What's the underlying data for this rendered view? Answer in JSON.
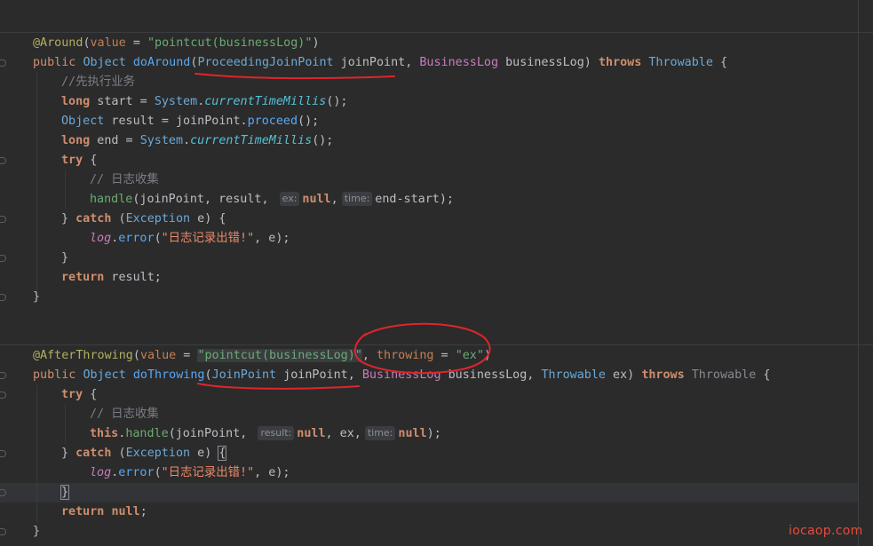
{
  "editor": {
    "watermark": "iocaop.com",
    "annotation_color": "#e0252b",
    "colors": {
      "background": "#2b2b2b",
      "keyword": "#cf8e6d",
      "annotation": "#b3ae60",
      "type": "#6aa9d8",
      "string": "#6aab73",
      "comment": "#7a7e85"
    }
  },
  "code": {
    "l1": {
      "t1": "@Around",
      "t2": "(",
      "t3": "value",
      "t4": " = ",
      "t5": "\"pointcut(businessLog)\"",
      "t6": ")"
    },
    "l2": {
      "t1": "public",
      "t2": " ",
      "t3": "Object",
      "t4": " ",
      "t5": "doAround",
      "t6": "(",
      "t7": "ProceedingJoinPoint",
      "t8": " joinPoint, ",
      "t9": "BusinessLog",
      "t10": " businessLog) ",
      "t11": "throws",
      "t12": " ",
      "t13": "Throwable",
      "t14": " {"
    },
    "l3": {
      "t1": "//先执行业务"
    },
    "l4": {
      "t1": "long",
      "t2": " start = ",
      "t3": "System",
      "t4": ".",
      "t5": "currentTimeMillis",
      "t6": "();"
    },
    "l5": {
      "t1": "Object",
      "t2": " result = joinPoint.",
      "t3": "proceed",
      "t4": "();"
    },
    "l6": {
      "t1": "long",
      "t2": " end = ",
      "t3": "System",
      "t4": ".",
      "t5": "currentTimeMillis",
      "t6": "();"
    },
    "l7": {
      "t1": "try",
      "t2": " {"
    },
    "l8": {
      "t1": "// 日志收集"
    },
    "l9": {
      "t1": "handle",
      "t2": "(joinPoint, result, ",
      "h1": "ex:",
      "t3": "null",
      "t4": ",",
      "h2": "time:",
      "t5": "end-start);"
    },
    "l10": {
      "t1": "} ",
      "t2": "catch",
      "t3": " (",
      "t4": "Exception",
      "t5": " e) {"
    },
    "l11": {
      "t1": "log",
      "t2": ".",
      "t3": "error",
      "t4": "(",
      "t5": "\"日志记录出错!\"",
      "t6": ", e);"
    },
    "l12": {
      "t1": "}"
    },
    "l13": {
      "t1": "return",
      "t2": " result;"
    },
    "l14": {
      "t1": "}"
    },
    "l15": {
      "t1": "@AfterThrowing",
      "t2": "(",
      "t3": "value",
      "t4": " = ",
      "t5": "\"pointcut(businessLog)\"",
      "t6": ", ",
      "t7": "throwing",
      "t8": " = ",
      "t9": "\"ex\"",
      "t10": ")"
    },
    "l16": {
      "t1": "public",
      "t2": " ",
      "t3": "Object",
      "t4": " ",
      "t5": "doThrowing",
      "t6": "(",
      "t7": "JoinPoint",
      "t8": " joinPoint, ",
      "t9": "BusinessLog",
      "t10": " businessLog, ",
      "t11": "Throwable",
      "t12": " ex) ",
      "t13": "throws",
      "t14": " ",
      "t15": "Throwable",
      "t16": " {"
    },
    "l17": {
      "t1": "try",
      "t2": " {"
    },
    "l18": {
      "t1": "// 日志收集"
    },
    "l19": {
      "t1": "this",
      "t2": ".",
      "t3": "handle",
      "t4": "(joinPoint, ",
      "h1": "result:",
      "t5": "null",
      "t6": ", ex,",
      "h2": "time:",
      "t7": "null",
      "t8": ");"
    },
    "l20": {
      "t1": "} ",
      "t2": "catch",
      "t3": " (",
      "t4": "Exception",
      "t5": " e) ",
      "t6": "{"
    },
    "l21": {
      "t1": "log",
      "t2": ".",
      "t3": "error",
      "t4": "(",
      "t5": "\"日志记录出错!\"",
      "t6": ", e);"
    },
    "l22": {
      "t1": "}"
    },
    "l23": {
      "t1": "return",
      "t2": " ",
      "t3": "null",
      "t4": ";"
    },
    "l24": {
      "t1": "}"
    }
  }
}
